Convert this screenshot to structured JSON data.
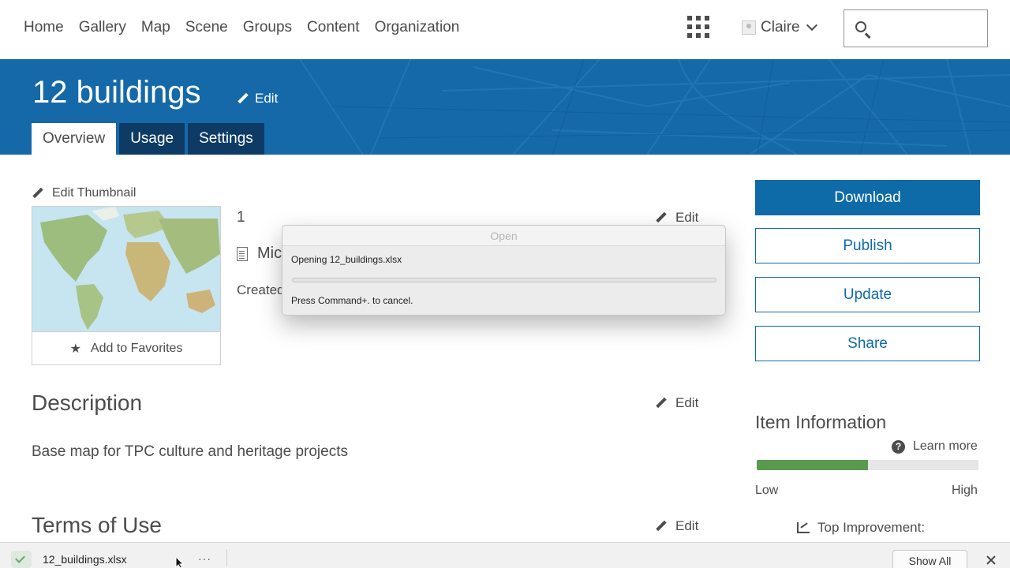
{
  "nav": {
    "links": [
      "Home",
      "Gallery",
      "Map",
      "Scene",
      "Groups",
      "Content",
      "Organization"
    ],
    "user_name": "Claire",
    "search_placeholder": ""
  },
  "banner": {
    "title": "12 buildings",
    "edit_label": "Edit",
    "tabs": [
      "Overview",
      "Usage",
      "Settings"
    ],
    "active_tab": "Overview"
  },
  "thumbnail": {
    "edit_label": "Edit Thumbnail",
    "favorites_label": "Add to Favorites"
  },
  "summary": {
    "text": "1",
    "edit_label": "Edit",
    "file_type_partial": "Mic",
    "created_partial": "Created"
  },
  "description": {
    "heading": "Description",
    "edit_label": "Edit",
    "text": "Base map for TPC culture and heritage projects"
  },
  "terms": {
    "heading": "Terms of Use",
    "edit_label": "Edit"
  },
  "actions": {
    "download": "Download",
    "publish": "Publish",
    "update": "Update",
    "share": "Share"
  },
  "item_info": {
    "heading": "Item Information",
    "learn_more": "Learn more",
    "score_fraction": 0.5,
    "low_label": "Low",
    "high_label": "High",
    "top_improvement": "Top Improvement:",
    "meter_color": "#5a9a4f"
  },
  "dialog": {
    "title": "Open",
    "message": "Opening 12_buildings.xlsx",
    "hint": "Press Command+. to cancel.",
    "progress_fraction": 0
  },
  "download_shelf": {
    "file_name": "12_buildings.xlsx",
    "more_label": "···",
    "show_all": "Show All"
  },
  "colors": {
    "accent": "#0e6ba8",
    "banner": "#1569a8",
    "tab_dark": "#0d3b66"
  }
}
